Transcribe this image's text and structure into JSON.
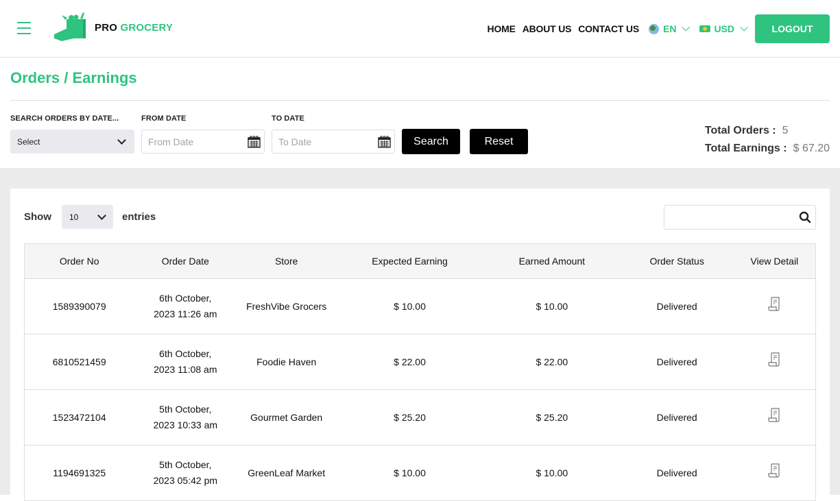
{
  "header": {
    "brand_first": "PRO",
    "brand_second": "GROCERY",
    "nav": [
      "HOME",
      "ABOUT US",
      "CONTACT US"
    ],
    "language": "EN",
    "currency": "USD",
    "logout_label": "LOGOUT",
    "accent_color": "#2ec47f"
  },
  "page": {
    "title": "Orders / Earnings"
  },
  "filters": {
    "search_by_label": "SEARCH ORDERS BY DATE...",
    "search_by_value": "Select",
    "from_label": "FROM DATE",
    "from_placeholder": "From Date",
    "to_label": "TO DATE",
    "to_placeholder": "To Date",
    "search_button": "Search",
    "reset_button": "Reset"
  },
  "totals": {
    "orders_label": "Total Orders :",
    "orders_value": "5",
    "earnings_label": "Total Earnings :",
    "earnings_value": "$ 67.20"
  },
  "table_controls": {
    "show_label": "Show",
    "entries_value": "10",
    "entries_label": "entries",
    "search_value": ""
  },
  "table": {
    "columns": [
      "Order No",
      "Order Date",
      "Store",
      "Expected Earning",
      "Earned Amount",
      "Order Status",
      "View Detail"
    ],
    "rows": [
      {
        "order_no": "1589390079",
        "date_line1": "6th October,",
        "date_line2": "2023 11:26 am",
        "store": "FreshVibe Grocers",
        "expected": "$ 10.00",
        "earned": "$ 10.00",
        "status": "Delivered"
      },
      {
        "order_no": "6810521459",
        "date_line1": "6th October,",
        "date_line2": "2023 11:08 am",
        "store": "Foodie Haven",
        "expected": "$ 22.00",
        "earned": "$ 22.00",
        "status": "Delivered"
      },
      {
        "order_no": "1523472104",
        "date_line1": "5th October,",
        "date_line2": "2023 10:33 am",
        "store": "Gourmet Garden",
        "expected": "$ 25.20",
        "earned": "$ 25.20",
        "status": "Delivered"
      },
      {
        "order_no": "1194691325",
        "date_line1": "5th October,",
        "date_line2": "2023 05:42 pm",
        "store": "GreenLeaf Market",
        "expected": "$ 10.00",
        "earned": "$ 10.00",
        "status": "Delivered"
      }
    ]
  }
}
